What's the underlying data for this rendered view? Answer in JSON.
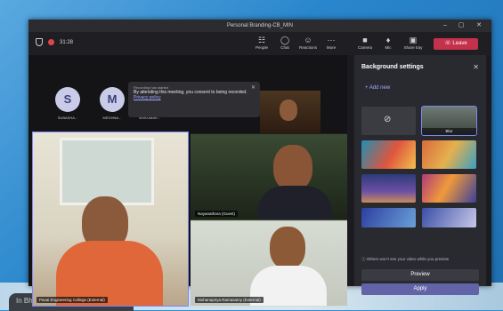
{
  "window": {
    "title": "Personal Branding-CB_MIN"
  },
  "toolbar": {
    "timer": "31:28",
    "buttons": [
      {
        "label": "People",
        "icon": "people-icon"
      },
      {
        "label": "Chat",
        "icon": "chat-icon"
      },
      {
        "label": "Reactions",
        "icon": "reactions-icon"
      },
      {
        "label": "More",
        "icon": "more-icon"
      },
      {
        "label": "Camera",
        "icon": "camera-icon"
      },
      {
        "label": "Mic",
        "icon": "mic-icon"
      },
      {
        "label": "Share tray",
        "icon": "share-tray-icon"
      }
    ],
    "leave_label": "Leave"
  },
  "participants": [
    {
      "initial": "S",
      "name": "SUBASHA..."
    },
    {
      "initial": "M",
      "name": "MEGHNA..."
    },
    {
      "name": "SRIKUMAR..."
    }
  ],
  "recording_notice": {
    "heading": "Recording has started",
    "text": "By attending this meeting, you consent to being recorded.",
    "link": "Privacy policy"
  },
  "videos": [
    {
      "name": "Pavai Engineering College (External)"
    },
    {
      "name": "Nayanathara (Guest)"
    },
    {
      "name": "Mohanapriya Ramasamy (External)"
    }
  ],
  "background_panel": {
    "title": "Background settings",
    "add_new": "Add new",
    "options": [
      {
        "label": "None"
      },
      {
        "label": "Blur"
      },
      {
        "label": ""
      },
      {
        "label": ""
      },
      {
        "label": ""
      },
      {
        "label": ""
      },
      {
        "label": ""
      },
      {
        "label": ""
      }
    ],
    "notice": "Others won't see your video while you preview",
    "preview_label": "Preview",
    "apply_label": "Apply",
    "colors": {
      "accent": "#7f85f5",
      "apply": "#6264a7",
      "leave": "#c4314b"
    }
  },
  "footer_tag": "In Bharat Sh..."
}
